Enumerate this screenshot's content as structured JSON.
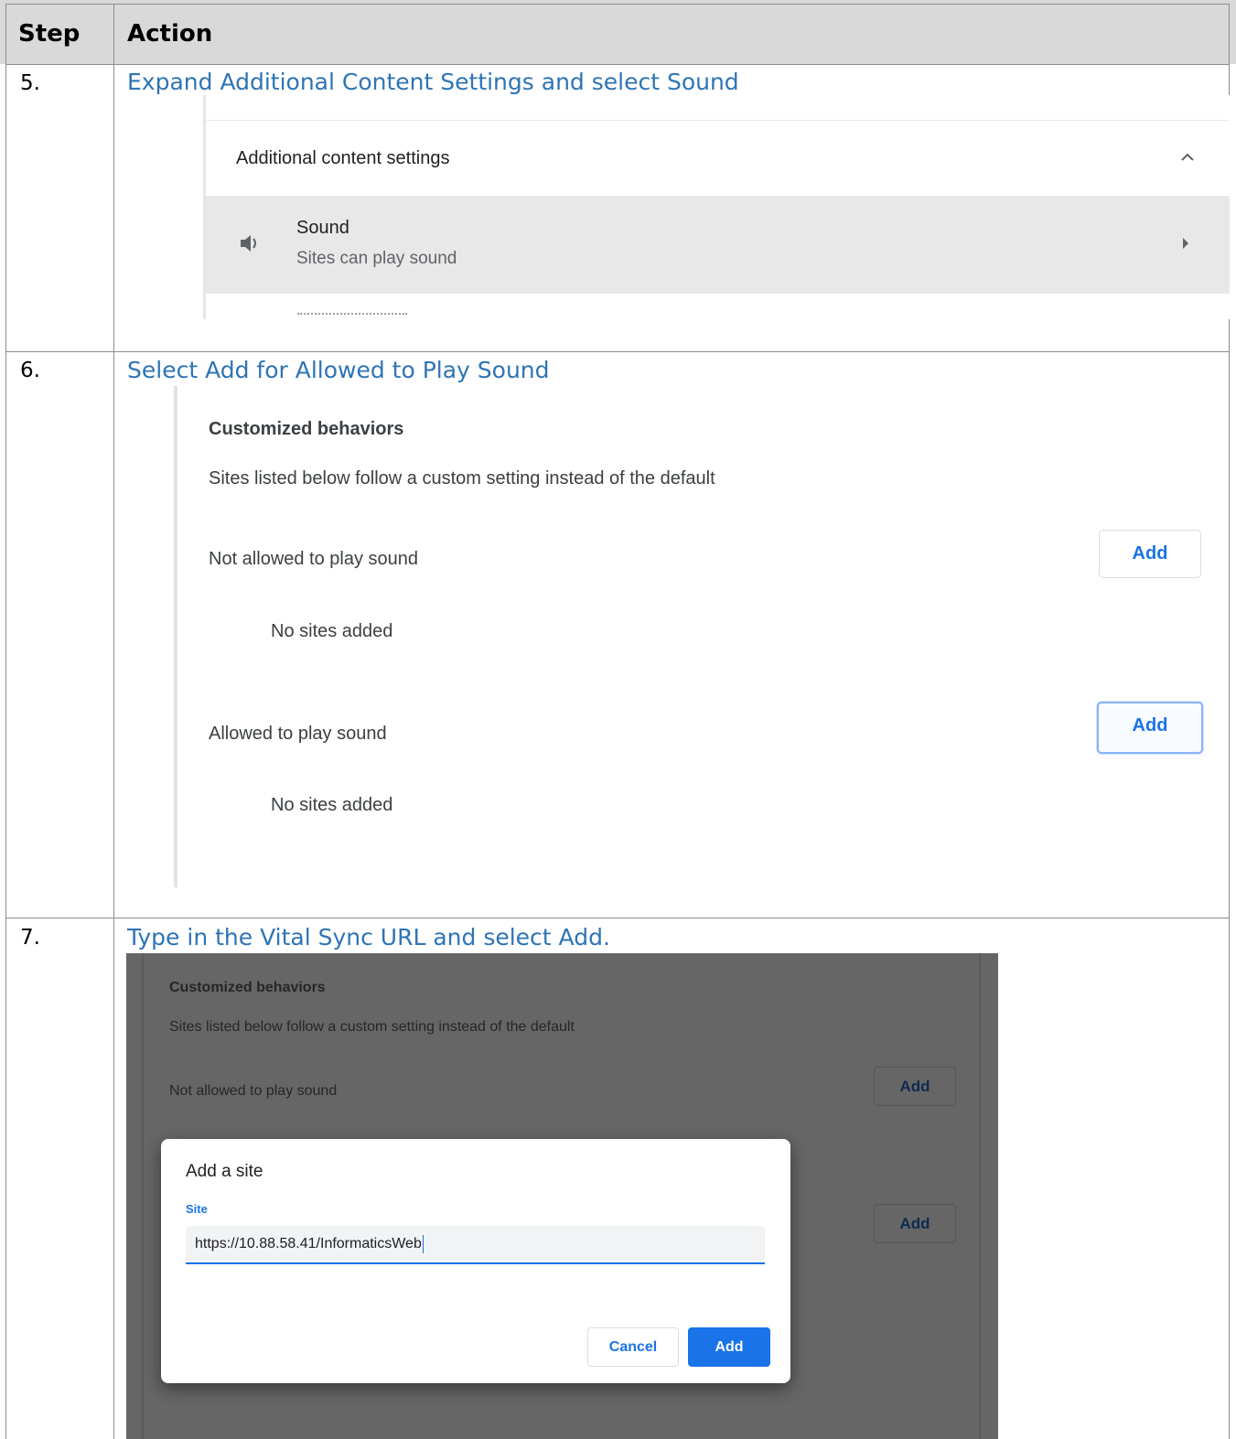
{
  "table": {
    "headers": {
      "step": "Step",
      "action": "Action"
    },
    "rows": [
      {
        "step": "5.",
        "action": "Expand Additional Content Settings and select Sound",
        "screenshot": {
          "section_title": "Additional content settings",
          "expand_icon": "chevron-up-icon",
          "item": {
            "icon": "speaker-icon",
            "title": "Sound",
            "subtitle": "Sites can play sound",
            "arrow_icon": "arrow-right-icon"
          }
        }
      },
      {
        "step": "6.",
        "action": "Select Add for Allowed to Play Sound",
        "screenshot": {
          "heading": "Customized behaviors",
          "description": "Sites listed below follow a custom setting instead of the default",
          "not_allowed_label": "Not allowed to play sound",
          "not_allowed_empty": "No sites added",
          "not_allowed_button": "Add",
          "allowed_label": "Allowed to play sound",
          "allowed_empty": "No sites added",
          "allowed_button": "Add"
        }
      },
      {
        "step": "7.",
        "action": "Type in the Vital Sync URL and select Add.",
        "screenshot": {
          "bg_heading": "Customized behaviors",
          "bg_description": "Sites listed below follow a custom setting instead of the default",
          "bg_not_allowed_label": "Not allowed to play sound",
          "bg_button_1": "Add",
          "bg_button_2": "Add",
          "dialog": {
            "title": "Add a site",
            "field_label": "Site",
            "field_value": "https://10.88.58.41/InformaticsWeb",
            "cancel_label": "Cancel",
            "add_label": "Add"
          }
        }
      }
    ]
  },
  "colors": {
    "header_bg": "#d9d9d9",
    "action_text": "#2e74b5",
    "chrome_blue": "#1a73e8",
    "dim_overlay": "#666666"
  }
}
